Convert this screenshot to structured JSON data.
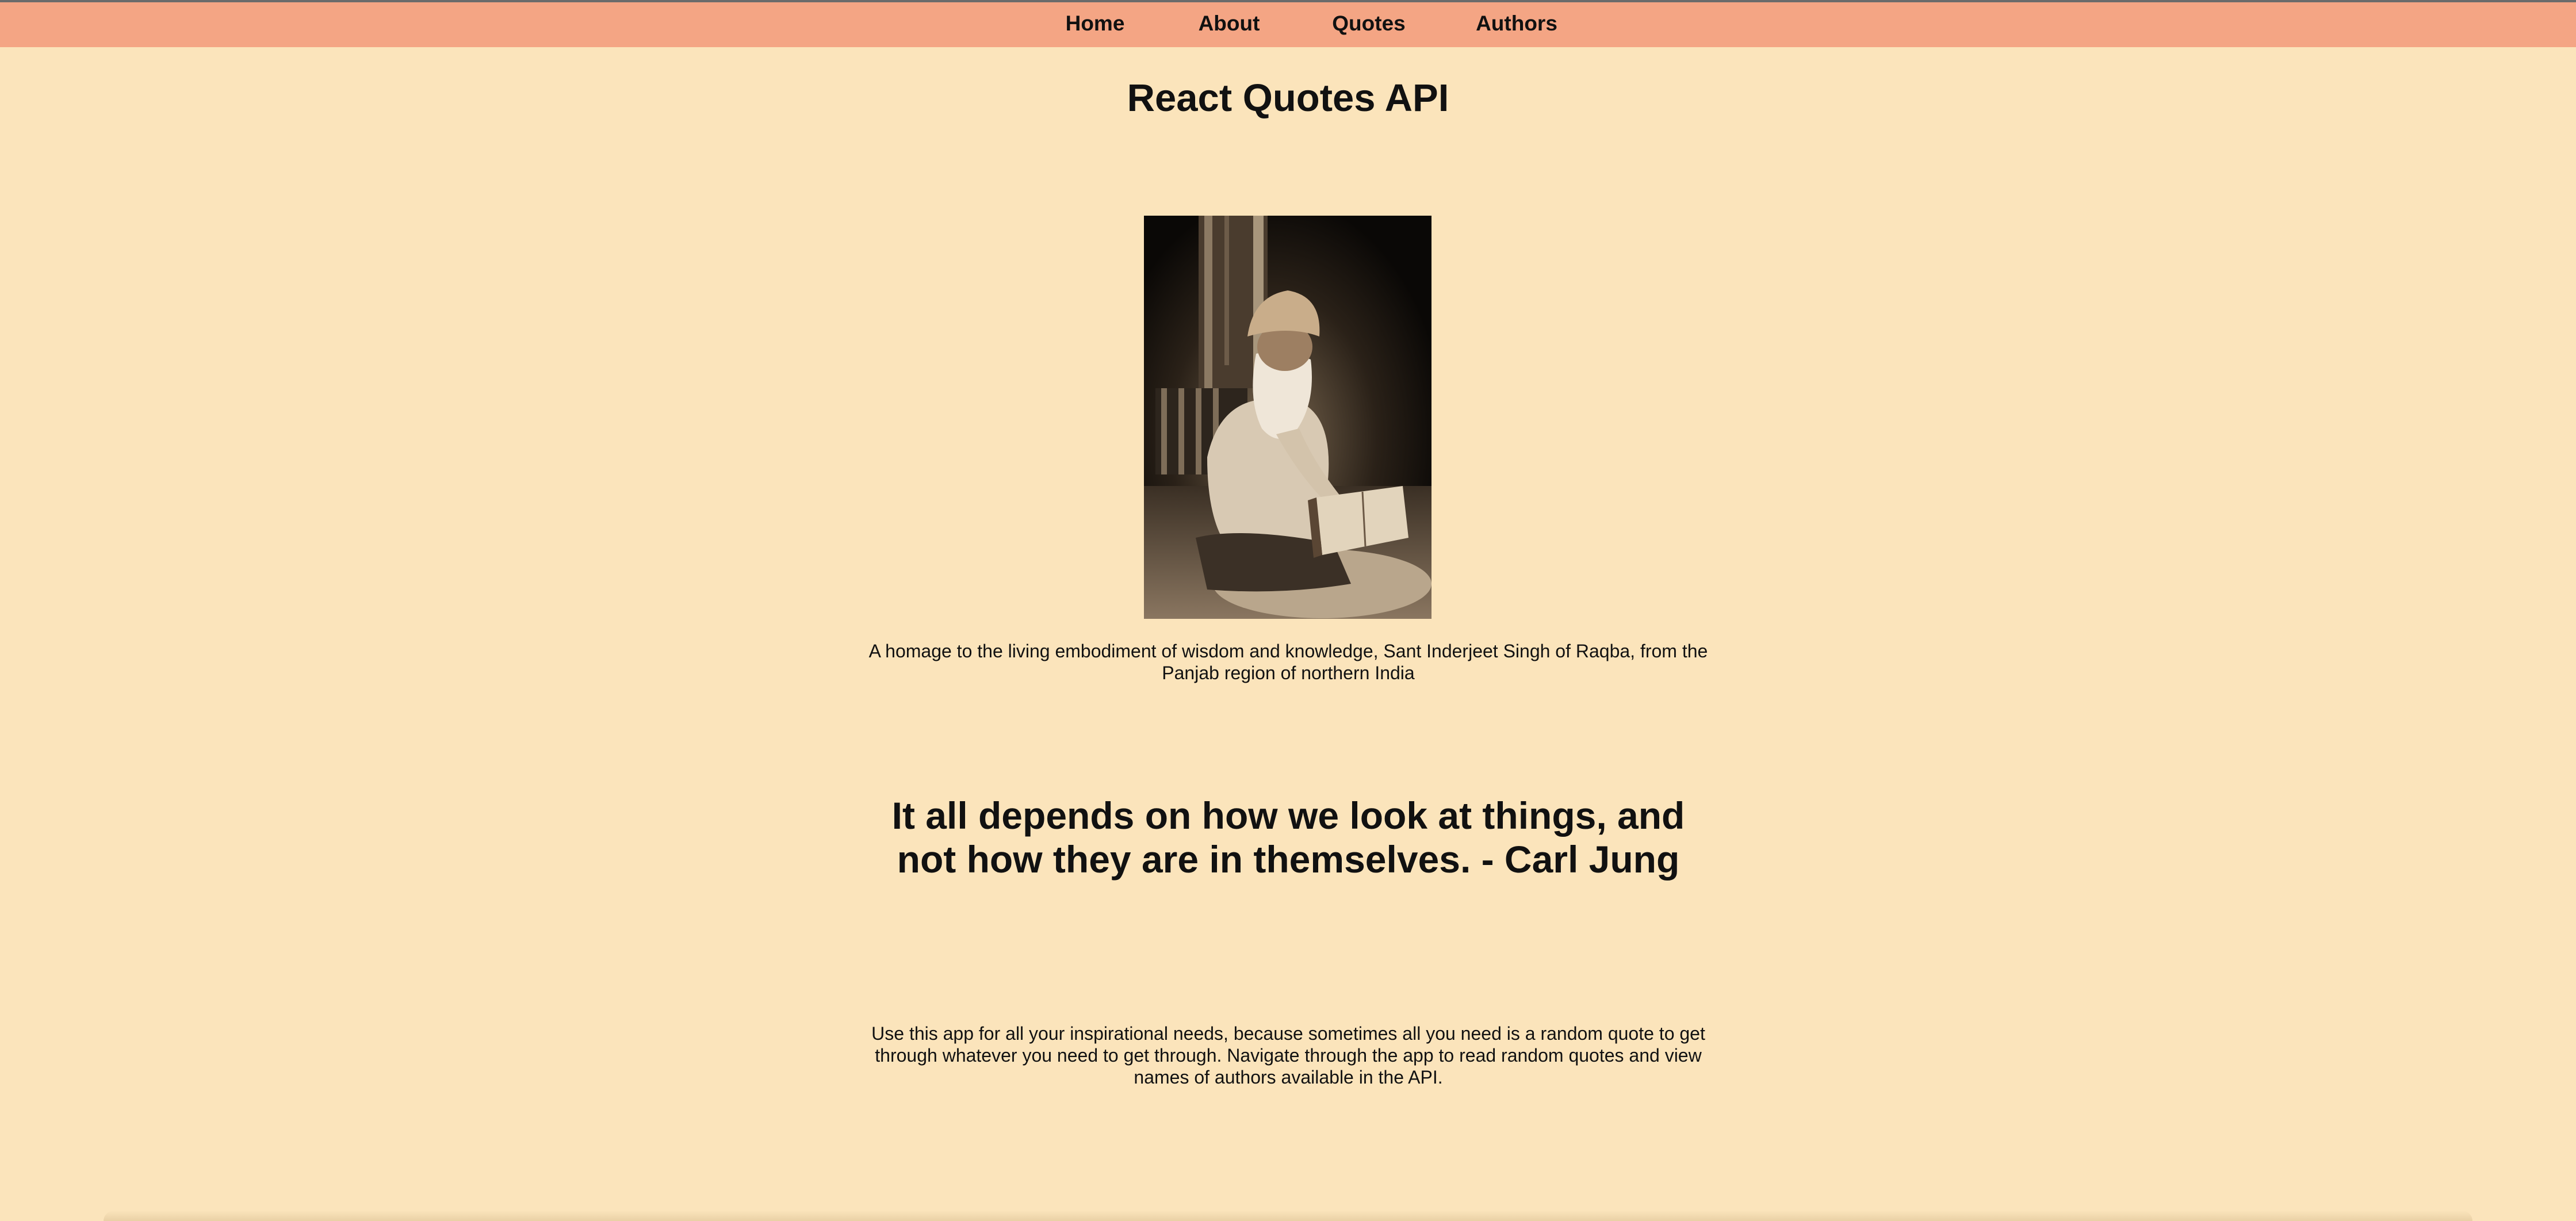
{
  "nav": {
    "items": [
      {
        "label": "Home"
      },
      {
        "label": "About"
      },
      {
        "label": "Quotes"
      },
      {
        "label": "Authors"
      }
    ]
  },
  "page": {
    "title": "React Quotes API",
    "caption": "A homage to the living embodiment of wisdom and knowledge, Sant Inderjeet Singh of Raqba, from the Panjab region of northern India",
    "quote": "It all depends on how we look at things, and not how they are in themselves. - Carl Jung",
    "intro": "Use this app for all your inspirational needs, because sometimes all you need is a random quote to get through whatever you need to get through. Navigate through the app to read random quotes and view names of authors available in the API."
  },
  "colors": {
    "background": "#fbe4bb",
    "navbar": "#f4a584",
    "text": "#111111"
  }
}
